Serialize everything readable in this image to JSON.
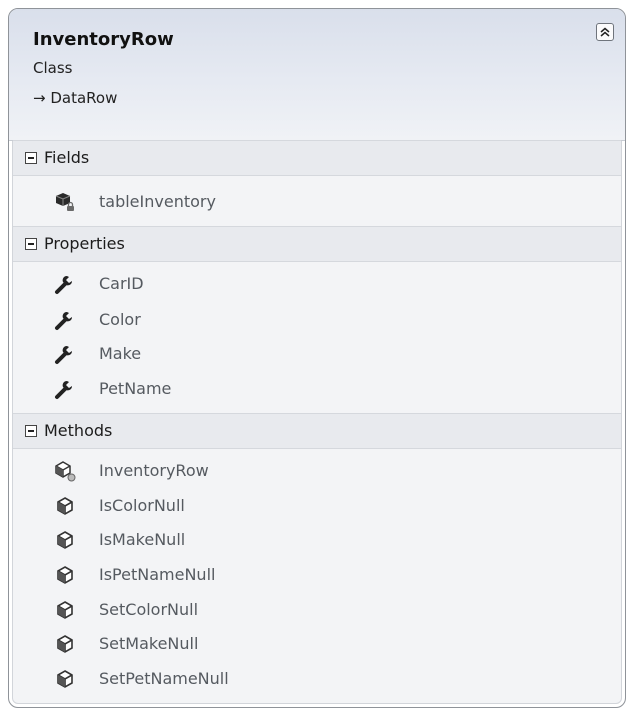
{
  "class": {
    "name": "InventoryRow",
    "kind": "Class",
    "base": "→ DataRow"
  },
  "fields": {
    "title": "Fields",
    "items": [
      {
        "name": "tableInventory",
        "icon": "field-private-icon"
      }
    ]
  },
  "properties": {
    "title": "Properties",
    "items": [
      {
        "name": "CarID",
        "icon": "wrench-icon"
      },
      {
        "name": "Color",
        "icon": "wrench-icon"
      },
      {
        "name": "Make",
        "icon": "wrench-icon"
      },
      {
        "name": "PetName",
        "icon": "wrench-icon"
      }
    ]
  },
  "methods": {
    "title": "Methods",
    "items": [
      {
        "name": "InventoryRow",
        "icon": "constructor-icon"
      },
      {
        "name": "IsColorNull",
        "icon": "method-icon"
      },
      {
        "name": "IsMakeNull",
        "icon": "method-icon"
      },
      {
        "name": "IsPetNameNull",
        "icon": "method-icon"
      },
      {
        "name": "SetColorNull",
        "icon": "method-icon"
      },
      {
        "name": "SetMakeNull",
        "icon": "method-icon"
      },
      {
        "name": "SetPetNameNull",
        "icon": "method-icon"
      }
    ]
  },
  "colors": {
    "header_gradient_top": "#d9dfeb",
    "section_band": "#e8eaee",
    "border": "#8f9399"
  }
}
